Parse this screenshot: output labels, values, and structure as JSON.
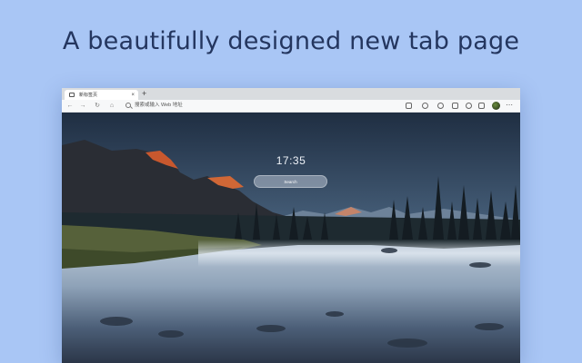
{
  "headline": "A beautifully designed new tab page",
  "browser": {
    "tab": {
      "favicon": "newtab-icon",
      "title": "新标签页",
      "close": "×"
    },
    "new_tab": "+",
    "toolbar": {
      "back": "←",
      "forward": "→",
      "refresh": "↻",
      "home": "⌂",
      "address_placeholder": "搜索或输入 Web 地址",
      "icons": [
        "read-aloud-icon",
        "translate-icon",
        "favorite-star-icon",
        "collections-icon",
        "extensions-icon",
        "favorites-icon",
        "shield-icon",
        "profile-avatar",
        "menu-icon"
      ],
      "menu": "⋯"
    }
  },
  "newtab": {
    "clock": "17:35",
    "search_placeholder": "Search"
  },
  "colors": {
    "page_background": "#a9c6f5",
    "headline": "#24365f"
  }
}
